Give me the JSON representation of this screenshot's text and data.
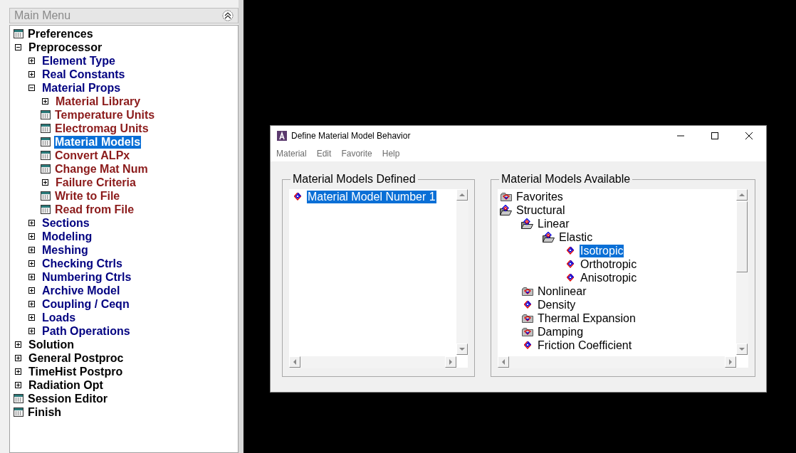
{
  "main_menu": {
    "title": "Main Menu",
    "items": [
      {
        "label": "Preferences",
        "kind": "leaf",
        "selected": false
      },
      {
        "label": "Preprocessor",
        "kind": "branch",
        "expanded": true,
        "selected": false,
        "children": [
          {
            "label": "Element Type",
            "kind": "branch",
            "expanded": false,
            "selected": false
          },
          {
            "label": "Real Constants",
            "kind": "branch",
            "expanded": false,
            "selected": false
          },
          {
            "label": "Material Props",
            "kind": "branch",
            "expanded": true,
            "selected": false,
            "children": [
              {
                "label": "Material Library",
                "kind": "branch",
                "expanded": false,
                "selected": false
              },
              {
                "label": "Temperature Units",
                "kind": "leaf",
                "selected": false
              },
              {
                "label": "Electromag Units",
                "kind": "leaf",
                "selected": false
              },
              {
                "label": "Material Models",
                "kind": "leaf",
                "selected": true
              },
              {
                "label": "Convert ALPx",
                "kind": "leaf",
                "selected": false
              },
              {
                "label": "Change Mat Num",
                "kind": "leaf",
                "selected": false
              },
              {
                "label": "Failure Criteria",
                "kind": "branch",
                "expanded": false,
                "selected": false
              },
              {
                "label": "Write to File",
                "kind": "leaf",
                "selected": false
              },
              {
                "label": "Read from File",
                "kind": "leaf",
                "selected": false
              }
            ]
          },
          {
            "label": "Sections",
            "kind": "branch",
            "expanded": false,
            "selected": false
          },
          {
            "label": "Modeling",
            "kind": "branch",
            "expanded": false,
            "selected": false
          },
          {
            "label": "Meshing",
            "kind": "branch",
            "expanded": false,
            "selected": false
          },
          {
            "label": "Checking Ctrls",
            "kind": "branch",
            "expanded": false,
            "selected": false
          },
          {
            "label": "Numbering Ctrls",
            "kind": "branch",
            "expanded": false,
            "selected": false
          },
          {
            "label": "Archive Model",
            "kind": "branch",
            "expanded": false,
            "selected": false
          },
          {
            "label": "Coupling / Ceqn",
            "kind": "branch",
            "expanded": false,
            "selected": false
          },
          {
            "label": "Loads",
            "kind": "branch",
            "expanded": false,
            "selected": false
          },
          {
            "label": "Path Operations",
            "kind": "branch",
            "expanded": false,
            "selected": false
          }
        ]
      },
      {
        "label": "Solution",
        "kind": "branch",
        "expanded": false,
        "selected": false
      },
      {
        "label": "General Postproc",
        "kind": "branch",
        "expanded": false,
        "selected": false
      },
      {
        "label": "TimeHist Postpro",
        "kind": "branch",
        "expanded": false,
        "selected": false
      },
      {
        "label": "Radiation Opt",
        "kind": "branch",
        "expanded": false,
        "selected": false
      },
      {
        "label": "Session Editor",
        "kind": "leaf",
        "selected": false
      },
      {
        "label": "Finish",
        "kind": "leaf",
        "selected": false
      }
    ]
  },
  "dialog": {
    "title": "Define Material Model Behavior",
    "menu": [
      "Material",
      "Edit",
      "Favorite",
      "Help"
    ],
    "defined": {
      "title": "Material Models Defined",
      "items": [
        {
          "label": "Material Model Number 1",
          "kind": "model",
          "selected": true
        }
      ]
    },
    "available": {
      "title": "Material Models Available",
      "items": [
        {
          "label": "Favorites",
          "kind": "folder",
          "selected": false
        },
        {
          "label": "Structural",
          "kind": "open-folder",
          "selected": false,
          "children": [
            {
              "label": "Linear",
              "kind": "open-folder",
              "selected": false,
              "children": [
                {
                  "label": "Elastic",
                  "kind": "open-folder",
                  "selected": false,
                  "children": [
                    {
                      "label": "Isotropic",
                      "kind": "model",
                      "selected": true
                    },
                    {
                      "label": "Orthotropic",
                      "kind": "model",
                      "selected": false
                    },
                    {
                      "label": "Anisotropic",
                      "kind": "model",
                      "selected": false
                    }
                  ]
                }
              ]
            },
            {
              "label": "Nonlinear",
              "kind": "folder",
              "selected": false
            },
            {
              "label": "Density",
              "kind": "model",
              "selected": false
            },
            {
              "label": "Thermal Expansion",
              "kind": "folder",
              "selected": false
            },
            {
              "label": "Damping",
              "kind": "folder",
              "selected": false
            },
            {
              "label": "Friction Coefficient",
              "kind": "model",
              "selected": false
            }
          ]
        }
      ]
    }
  }
}
